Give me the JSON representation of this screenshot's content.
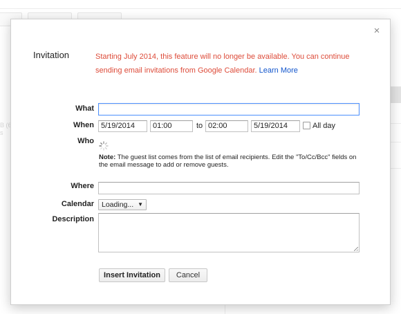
{
  "dialog": {
    "title": "Invitation",
    "close_symbol": "×",
    "notice_text": "Starting July 2014, this feature will no longer be available. You can continue sending email invitations from Google Calendar.",
    "notice_link": "Learn More"
  },
  "form": {
    "what_label": "What",
    "what_value": "",
    "when_label": "When",
    "start_date": "5/19/2014",
    "start_time": "01:00",
    "to_label": "to",
    "end_time": "02:00",
    "end_date": "5/19/2014",
    "all_day_label": "All day",
    "who_label": "Who",
    "note_label": "Note:",
    "note_text": "The guest list comes from the list of email recipients. Edit the \"To/Cc/Bcc\" fields on the email message to add or remove guests.",
    "where_label": "Where",
    "where_value": "",
    "calendar_label": "Calendar",
    "calendar_value": "Loading...",
    "description_label": "Description",
    "description_value": ""
  },
  "buttons": {
    "insert_label": "Insert Invitation",
    "cancel_label": "Cancel"
  },
  "background": {
    "left_text_1": "B (6",
    "left_text_2": "s"
  },
  "colors": {
    "notice": "#dd4b39",
    "link": "#1155cc",
    "focus": "#4d90fe"
  }
}
